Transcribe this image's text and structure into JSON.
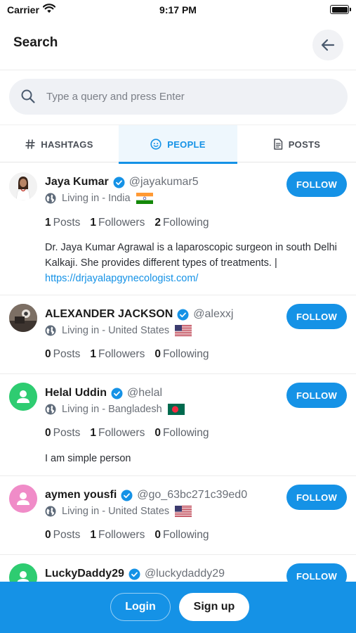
{
  "status_bar": {
    "carrier": "Carrier",
    "time": "9:17 PM"
  },
  "header": {
    "title": "Search"
  },
  "search": {
    "placeholder": "Type a query and press Enter",
    "value": ""
  },
  "tabs": [
    {
      "label": "HASHTAGS",
      "icon": "hashtag-icon",
      "active": false
    },
    {
      "label": "PEOPLE",
      "icon": "people-icon",
      "active": true
    },
    {
      "label": "POSTS",
      "icon": "document-icon",
      "active": false
    }
  ],
  "people": [
    {
      "name": "Jaya Kumar",
      "handle": "@jayakumar5",
      "location": "Living in - India",
      "flag": "india-flag-icon",
      "posts": "1",
      "posts_label": "Posts",
      "followers": "1",
      "followers_label": "Followers",
      "following": "2",
      "following_label": "Following",
      "bio": "Dr. Jaya Kumar Agrawal is a laparoscopic surgeon in south Delhi Kalkaji. She provides different types of treatments. |",
      "bio_link": "https://drjayalapgynecologist.com/",
      "follow_label": "FOLLOW"
    },
    {
      "name": "ALEXANDER JACKSON",
      "handle": "@alexxj",
      "location": "Living in - United States",
      "flag": "usa-flag-icon",
      "posts": "0",
      "posts_label": "Posts",
      "followers": "1",
      "followers_label": "Followers",
      "following": "0",
      "following_label": "Following",
      "follow_label": "FOLLOW"
    },
    {
      "name": "Helal Uddin",
      "handle": "@helal",
      "location": "Living in - Bangladesh",
      "flag": "bangladesh-flag-icon",
      "posts": "0",
      "posts_label": "Posts",
      "followers": "1",
      "followers_label": "Followers",
      "following": "0",
      "following_label": "Following",
      "bio": "I am simple person",
      "follow_label": "FOLLOW"
    },
    {
      "name": "aymen yousfi",
      "handle": "@go_63bc271c39ed0",
      "location": "Living in - United States",
      "flag": "usa-flag-icon",
      "posts": "0",
      "posts_label": "Posts",
      "followers": "1",
      "followers_label": "Followers",
      "following": "0",
      "following_label": "Following",
      "follow_label": "FOLLOW"
    },
    {
      "name": "LuckyDaddy29",
      "handle": "@luckydaddy29",
      "follow_label": "FOLLOW"
    }
  ],
  "auth": {
    "login_label": "Login",
    "signup_label": "Sign up"
  },
  "colors": {
    "accent": "#1592e6",
    "avatar_green": "#2ecc71",
    "avatar_pink": "#f08cc8"
  }
}
